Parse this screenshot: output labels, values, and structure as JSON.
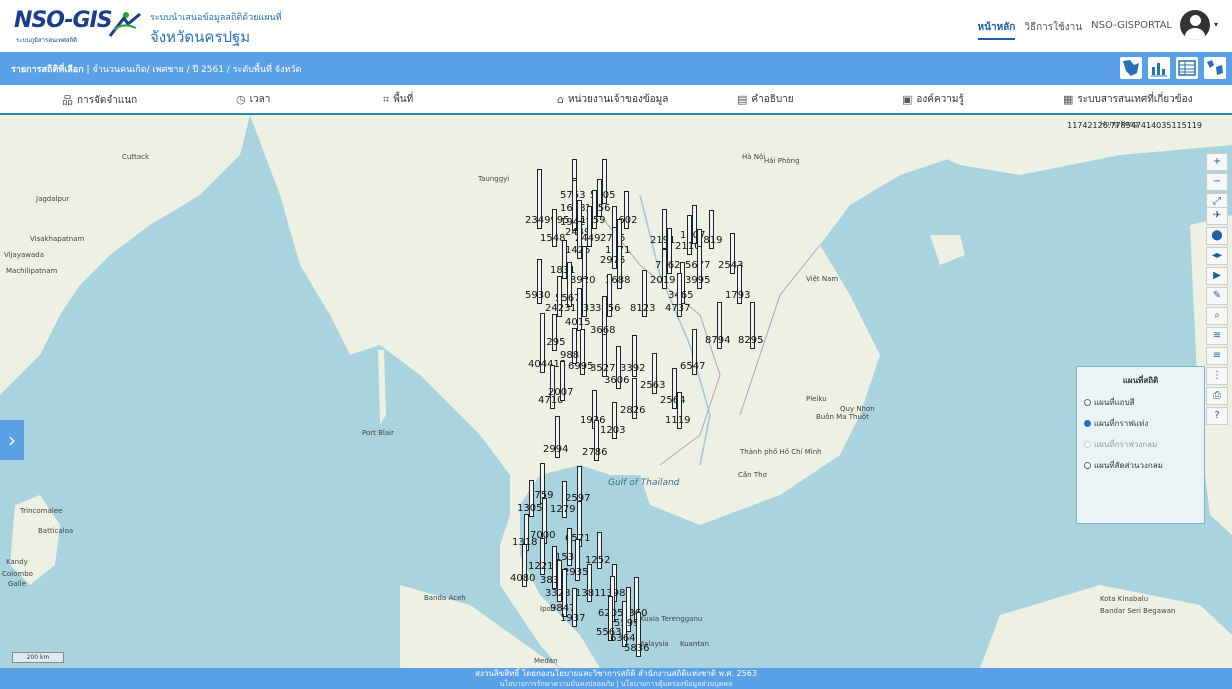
{
  "header": {
    "logo_text": "NSO-GIS",
    "logo_sub": "ระบบภูมิสารสนเทศสถิติ",
    "site_title": "ระบบนำเสนอข้อมูลสถิติด้วยแผนที่",
    "site_subtitle": "จังหวัดนครปฐม",
    "nav": [
      "หน้าหลัก",
      "วิธีการใช้งาน",
      "NSO-GISPORTAL"
    ]
  },
  "selection": {
    "label": "รายการสถิติที่เลือก",
    "value": "จำนวนคนเกิด/ เพศชาย / ปี 2561 / ระดับพื้นที่ จังหวัด"
  },
  "menu": [
    {
      "icon": "sitemap-icon",
      "glyph": "品",
      "label": "การจัดจำแนก"
    },
    {
      "icon": "clock-icon",
      "glyph": "◷",
      "label": "เวลา"
    },
    {
      "icon": "area-icon",
      "glyph": "⌗",
      "label": "พื้นที่"
    },
    {
      "icon": "institution-icon",
      "glyph": "⌂",
      "label": "หน่วยงานเจ้าของข้อมูล"
    },
    {
      "icon": "book-icon",
      "glyph": "▤",
      "label": "คำอธิบาย"
    },
    {
      "icon": "knowledge-icon",
      "glyph": "▣",
      "label": "องค์ความรู้"
    },
    {
      "icon": "related-systems-icon",
      "glyph": "▦",
      "label": "ระบบสารสนเทศที่เกี่ยวข้อง"
    }
  ],
  "map": {
    "coordinates": "11742126.778547414035115119",
    "scale": "200 km",
    "labels": [
      "Cuttack",
      "Jagdalpur",
      "Visakhapatnam",
      "Vijayawada",
      "Machilipatnam",
      "Port Blair",
      "Gulf of Thailand",
      "Hà Nội",
      "Hải Phòng",
      "Thành phố Hồ Chí Minh",
      "Cần Thơ",
      "Pleiku",
      "Quy Nhơn",
      "Buôn Ma Thuột",
      "Banda Aceh",
      "Medan",
      "Kuala Terengganu",
      "Kota Kinabalu",
      "Bandar Seri Begawan",
      "Trincomalee",
      "Batticaloa",
      "Kandy",
      "Colombo",
      "Galle",
      "Việt Nam",
      "Hong Kong",
      "Taunggyi",
      "Malaysia",
      "Kuantan",
      "Ipoh"
    ]
  },
  "chart_data": {
    "type": "bar",
    "title": "",
    "values": [
      5753,
      5405,
      1658,
      1556,
      2349995,
      19427,
      1659,
      1602,
      2449,
      1548,
      2449,
      2715,
      1425,
      1971,
      1907,
      1819,
      2191,
      2110,
      1831,
      2975,
      7062,
      5677,
      2543,
      3920,
      3688,
      2019,
      3995,
      5930,
      5567,
      3465,
      1793,
      2423,
      1833,
      3556,
      8123,
      4737,
      4015,
      3668,
      1295,
      988,
      8794,
      8295,
      404413,
      6995,
      3527,
      3392,
      3606,
      6547,
      2563,
      4710,
      2564,
      2007,
      2826,
      1936,
      1203,
      1119,
      2994,
      2786,
      2759,
      2597,
      1305,
      1279,
      7000,
      6571,
      1318,
      1536,
      1252,
      1221,
      2935,
      4080,
      3836,
      3328,
      1381,
      1398,
      9847,
      5360,
      1937,
      6205,
      5599,
      5563,
      6364,
      5836
    ]
  },
  "legend": {
    "title": "แผนที่สถิติ",
    "options": [
      {
        "label": "แผนที่แถบสี",
        "selected": false,
        "disabled": false
      },
      {
        "label": "แผนที่กราฟแท่ง",
        "selected": true,
        "disabled": false
      },
      {
        "label": "แผนที่กราฟวงกลม",
        "selected": false,
        "disabled": true
      },
      {
        "label": "แผนที่สัดส่วนวงกลม",
        "selected": false,
        "disabled": false
      }
    ]
  },
  "footer": {
    "line1": "สงวนลิขสิทธิ์ โดยกองนโยบายและวิชาการสถิติ สำนักงานสถิติแห่งชาติ พ.ศ. 2563",
    "line2": "นโยบายการรักษาความมั่นคงปลอดภัย | นโยบายการคุ้มครองข้อมูลส่วนบุคคล"
  }
}
